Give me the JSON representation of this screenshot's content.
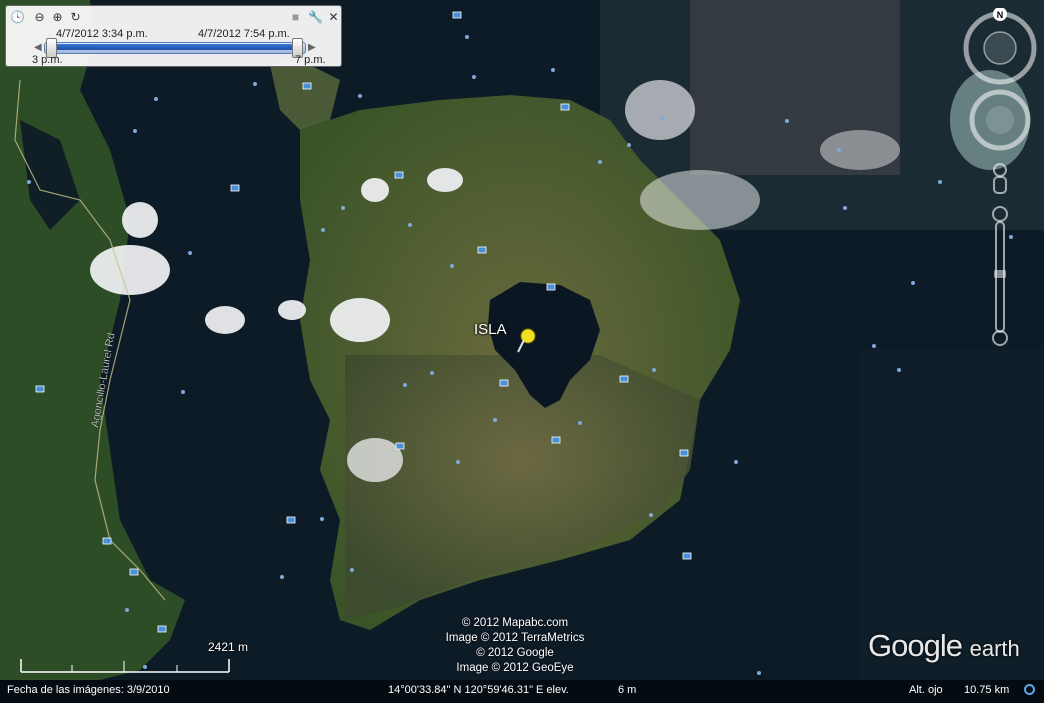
{
  "time_slider": {
    "start_label": "4/7/2012   3:34 p.m.",
    "end_label": "4/7/2012   7:54 p.m.",
    "range_start": "3 p.m.",
    "range_end": "7 p.m."
  },
  "map": {
    "place_label": "ISLA",
    "road_label": "Agoncillo-Laurel Rd"
  },
  "scale": {
    "label": "2421 m"
  },
  "credits": [
    "© 2012 Mapabc.com",
    "Image © 2012 TerraMetrics",
    "© 2012 Google",
    "Image © 2012 GeoEye"
  ],
  "logo": {
    "google": "Google",
    "earth": "earth"
  },
  "status_bar": {
    "imagery_date": "Fecha de las imágenes: 3/9/2010",
    "coordinates": "14°00'33.84\" N 120°59'46.31\" E elev.",
    "elevation": "6 m",
    "eye_alt_label": "Alt. ojo",
    "eye_alt_value": "10.75 km"
  },
  "nav": {
    "north_label": "N"
  },
  "colors": {
    "water": "#0d1b27",
    "land": "#3d5a2c",
    "cloud": "#f2f4f6",
    "pin": "#f0e020"
  }
}
